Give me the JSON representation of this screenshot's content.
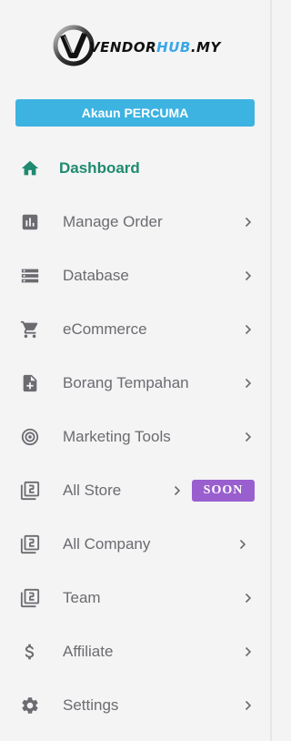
{
  "brand": {
    "text_main": "VENDOR",
    "text_accent": "HUB",
    "text_tld": ".MY"
  },
  "plan_badge": "Akaun PERCUMA",
  "colors": {
    "accent": "#1f8a6f",
    "badge_bg": "#3db3e1",
    "soon_bg": "#9a5fce",
    "icon": "#6b6b70"
  },
  "menu": [
    {
      "label": "Dashboard",
      "icon": "home-icon",
      "active": true
    },
    {
      "label": "Manage Order",
      "icon": "chart-icon"
    },
    {
      "label": "Database",
      "icon": "storage-icon"
    },
    {
      "label": "eCommerce",
      "icon": "cart-icon"
    },
    {
      "label": "Borang Tempahan",
      "icon": "note-add-icon"
    },
    {
      "label": "Marketing Tools",
      "icon": "target-icon"
    },
    {
      "label": "All Store",
      "icon": "filter-2-icon",
      "badge": "SOON"
    },
    {
      "label": "All Company",
      "icon": "filter-2-icon"
    },
    {
      "label": "Team",
      "icon": "filter-2-icon"
    },
    {
      "label": "Affiliate",
      "icon": "dollar-icon"
    },
    {
      "label": "Settings",
      "icon": "gear-icon"
    }
  ]
}
